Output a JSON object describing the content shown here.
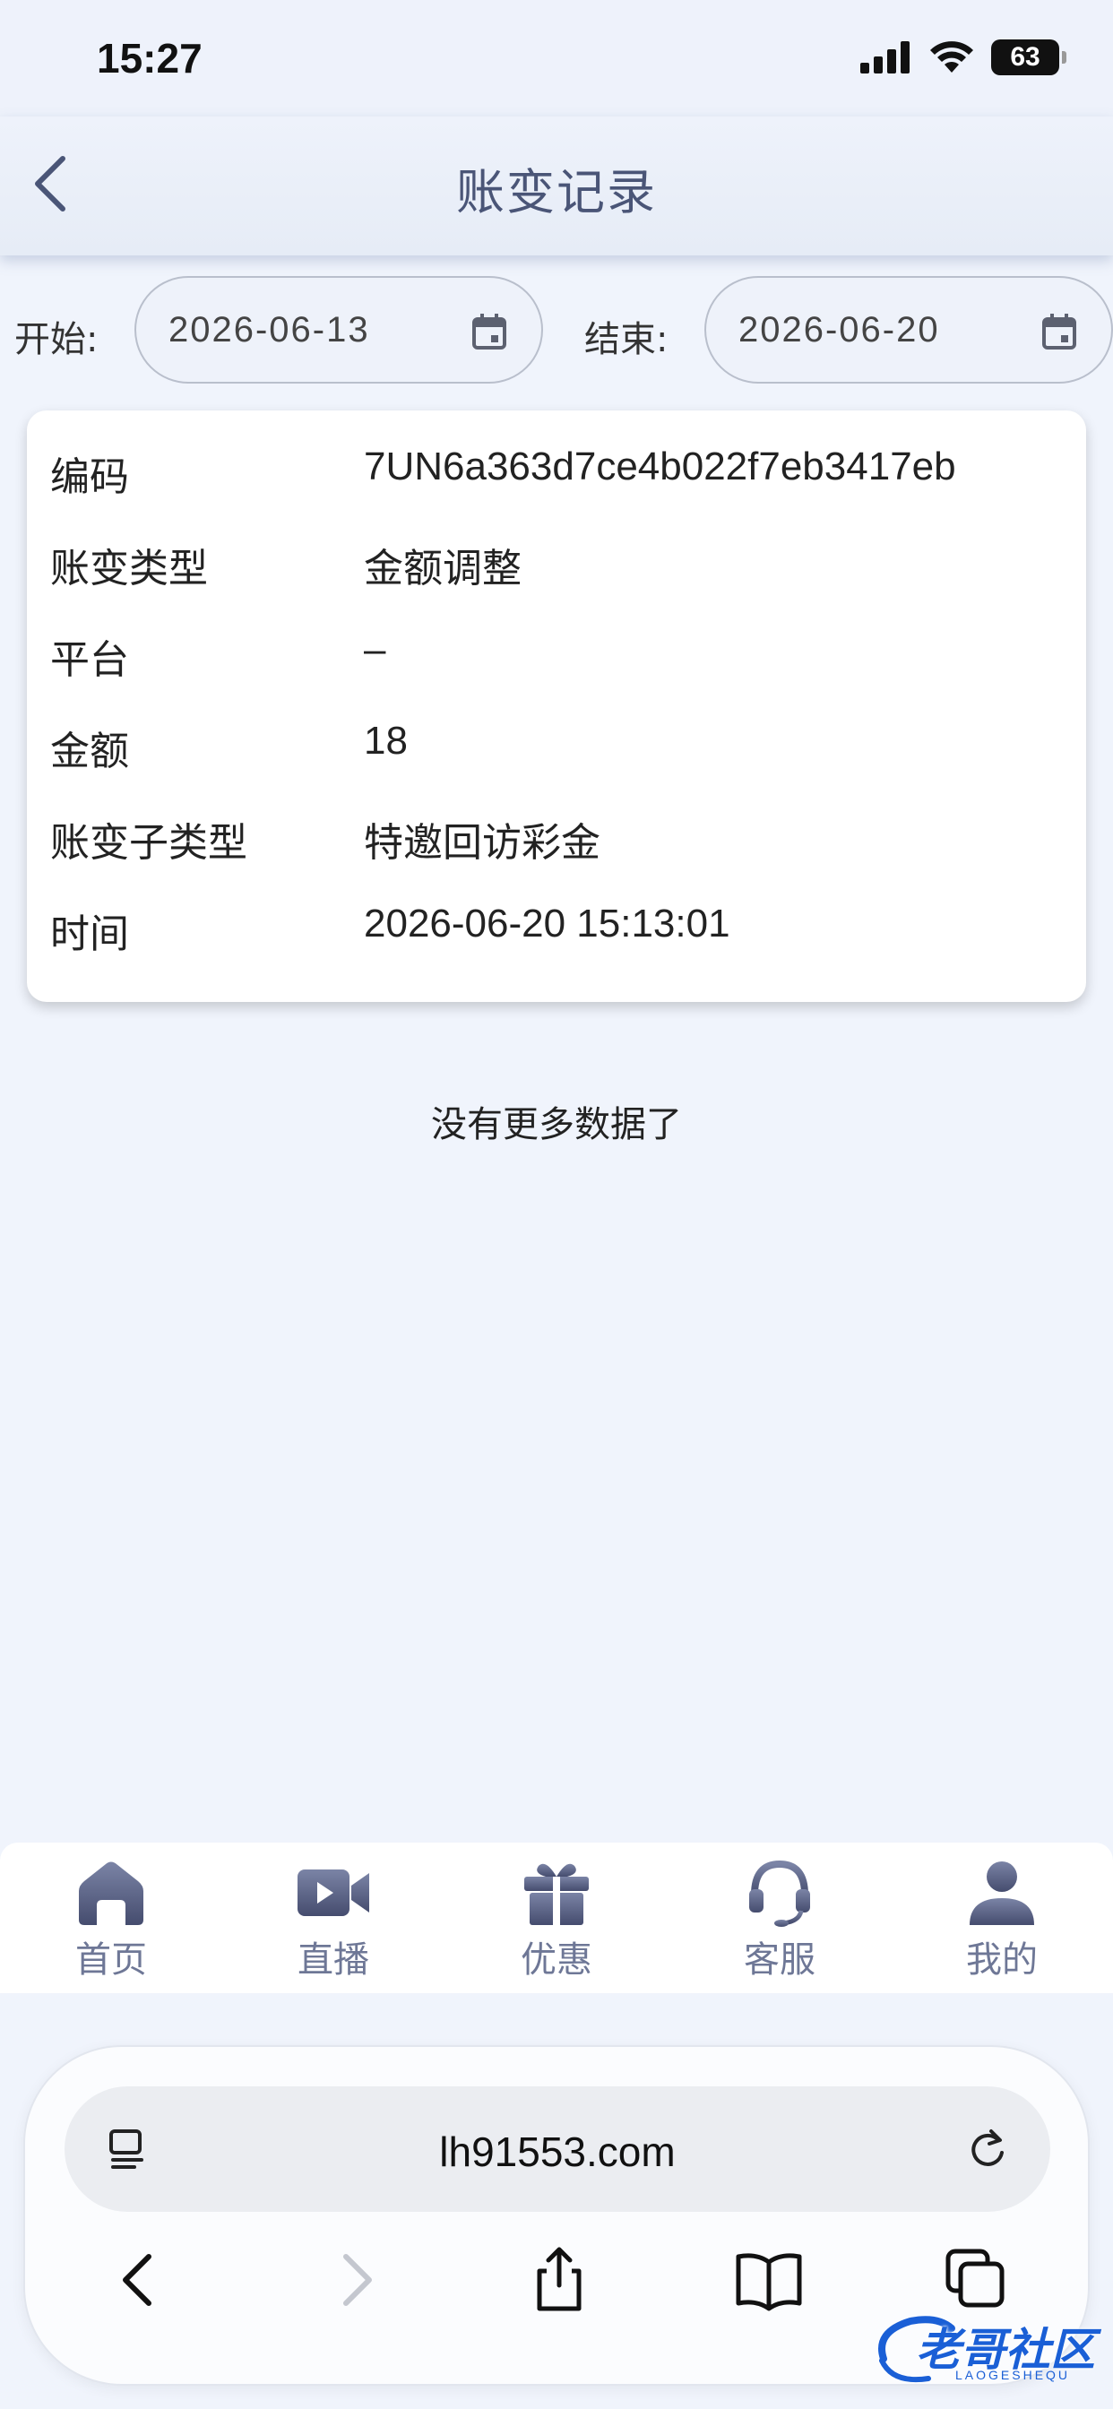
{
  "status_bar": {
    "time": "15:27",
    "battery": "63"
  },
  "header": {
    "title": "账变记录"
  },
  "filters": {
    "start_label": "开始:",
    "start_value": "2026-06-13",
    "end_label": "结束:",
    "end_value": "2026-06-20"
  },
  "record": {
    "rows": [
      {
        "key": "编码",
        "value": "7UN6a363d7ce4b022f7eb3417eb"
      },
      {
        "key": "账变类型",
        "value": "金额调整"
      },
      {
        "key": "平台",
        "value": "–"
      },
      {
        "key": "金额",
        "value": "18"
      },
      {
        "key": "账变子类型",
        "value": "特邀回访彩金"
      },
      {
        "key": "时间",
        "value": "2026-06-20 15:13:01"
      }
    ]
  },
  "list_end_text": "没有更多数据了",
  "tabbar": {
    "tabs": [
      {
        "label": "首页",
        "icon": "home-icon"
      },
      {
        "label": "直播",
        "icon": "video-camera-icon"
      },
      {
        "label": "优惠",
        "icon": "gift-icon"
      },
      {
        "label": "客服",
        "icon": "headset-icon"
      },
      {
        "label": "我的",
        "icon": "user-icon"
      }
    ]
  },
  "browser": {
    "url": "lh91553.com"
  },
  "watermark": {
    "text": "老哥社区",
    "sub": "LAOGESHEQU"
  }
}
